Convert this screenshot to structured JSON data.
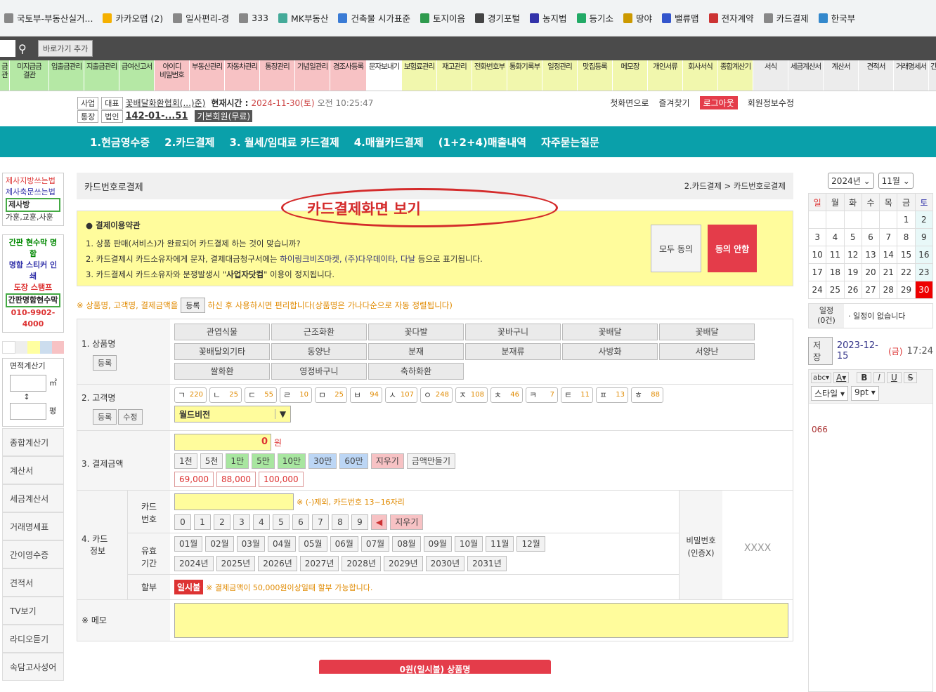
{
  "bookmarks": [
    "국토부-부동산실거...",
    "카카오맵 (2)",
    "일사편리-경",
    "333",
    "MK부동산",
    "건축물 시가표준",
    "토지이음",
    "경기포털",
    "농지법",
    "등기소",
    "땅야",
    "밸류맵",
    "전자계약",
    "카드결제",
    "한국부"
  ],
  "goto_label": "바로가기 추가",
  "menu": [
    {
      "l1": "금",
      "l2": "관",
      "c": "c-g",
      "w": 14
    },
    {
      "l1": "미지급금",
      "l2": "결관",
      "c": "c-g",
      "w": 56
    },
    {
      "l1": "입출금관리",
      "l2": "",
      "c": "c-g",
      "w": 50
    },
    {
      "l1": "지출금관리",
      "l2": "",
      "c": "c-g",
      "w": 50
    },
    {
      "l1": "급여신고서",
      "l2": "",
      "c": "c-g",
      "w": 50
    },
    {
      "l1": "아이디",
      "l2": "비밀번호",
      "c": "c-p",
      "w": 50
    },
    {
      "l1": "부동산관리",
      "l2": "",
      "c": "c-p",
      "w": 50
    },
    {
      "l1": "자동차관리",
      "l2": "",
      "c": "c-p",
      "w": 50
    },
    {
      "l1": "통장관리",
      "l2": "",
      "c": "c-p",
      "w": 50
    },
    {
      "l1": "기념일관리",
      "l2": "",
      "c": "c-p",
      "w": 50
    },
    {
      "l1": "경조사등록",
      "l2": "",
      "c": "c-p",
      "w": 52
    },
    {
      "l1": "문자보내기",
      "l2": "",
      "c": "c-w",
      "w": 50
    },
    {
      "l1": "보험료관리",
      "l2": "",
      "c": "c-y",
      "w": 50
    },
    {
      "l1": "재고관리",
      "l2": "",
      "c": "c-y",
      "w": 50
    },
    {
      "l1": "전화번호부",
      "l2": "",
      "c": "c-y",
      "w": 50
    },
    {
      "l1": "통화기록부",
      "l2": "",
      "c": "c-y",
      "w": 50
    },
    {
      "l1": "일정관리",
      "l2": "",
      "c": "c-y",
      "w": 50
    },
    {
      "l1": "맛집등록",
      "l2": "",
      "c": "c-y",
      "w": 50
    },
    {
      "l1": "메모장",
      "l2": "",
      "c": "c-y",
      "w": 50
    },
    {
      "l1": "개인서류",
      "l2": "",
      "c": "c-y",
      "w": 50
    },
    {
      "l1": "회사서식",
      "l2": "",
      "c": "c-y",
      "w": 50
    },
    {
      "l1": "종합계산기",
      "l2": "",
      "c": "c-y",
      "w": 50
    },
    {
      "l1": "서식",
      "l2": "",
      "c": "c-gr",
      "w": 50
    },
    {
      "l1": "세금계산서",
      "l2": "",
      "c": "c-gr",
      "w": 50
    },
    {
      "l1": "계산서",
      "l2": "",
      "c": "c-gr",
      "w": 50
    },
    {
      "l1": "견적서",
      "l2": "",
      "c": "c-gr",
      "w": 50
    },
    {
      "l1": "거래명세서",
      "l2": "",
      "c": "c-gr",
      "w": 50
    },
    {
      "l1": "간",
      "l2": "",
      "c": "c-gr",
      "w": 14
    }
  ],
  "info": {
    "tag_biz": "사업",
    "tag_rep": "대표",
    "company": "꽃배달화환협회(...)준)",
    "tag_bank": "통장",
    "tag_corp": "법인",
    "biznum": "142-01-...51",
    "time_label": "현재시간 :",
    "date": "2024-11-30",
    "dow": "(토)",
    "time": "오전 10:25:47",
    "member": "기본회원(무료)",
    "home": "첫화면으로",
    "fav": "즐겨찾기",
    "logout": "로그아웃",
    "edit": "회원정보수정"
  },
  "nav": [
    "1.현금영수증",
    "2.카드결제",
    "3. 월세/임대료 카드결제",
    "4.매월카드결제",
    "(1+2+4)매출내역",
    "자주묻는질문"
  ],
  "left": {
    "a1": "제사지방쓰는법",
    "a2": "제사축문쓰는법",
    "a3": "제사방",
    "a4": "가훈,교훈,사훈",
    "b1": "간판 현수막 명함",
    "b2": "명함 스티커 인쇄",
    "b3": "도장 스탬프",
    "b4": "간판명함현수막",
    "phone": "010-9902-4000",
    "calc": "면적계산기",
    "unit1": "㎡",
    "unit2": "평",
    "btns": [
      "종합계산기",
      "계산서",
      "세금계산서",
      "거래명세표",
      "간이영수증",
      "견적서",
      "TV보기",
      "라디오듣기",
      "속담고사성어"
    ]
  },
  "header": {
    "title": "카드번호로결제",
    "crumb": "2.카드결제 > 카드번호로결제"
  },
  "bubble": "카드결제화면 보기",
  "terms": {
    "title": "● 결제이용약관",
    "l1": "1. 상품 판매(서비스)가 완료되어 카드결제 하는 것이 맞습니까?",
    "l2a": "2. 카드결제시 카드소유자에게 문자, 결제대금청구서에는 ",
    "l2b": "하이링크비즈마켓, (주)다우데이타, 다날",
    "l2c": " 등으로 표기됩니다.",
    "l3a": "3. 카드결제시 카드소유자와 분쟁발생시 \"",
    "l3b": "사업자닷컴",
    "l3c": "\" 이용이 정지됩니다.",
    "agree_all": "모두 동의",
    "disagree": "동의 안함"
  },
  "note": {
    "a": "※ 상품명, 고객명, 결제금액을",
    "btn": "등록",
    "b": "하신 후 사용하시면 편리합니다(상품명은 가나다순으로 자동 정렬됩니다)"
  },
  "product": {
    "label": "1. 상품명",
    "reg": "등록",
    "items": [
      "관엽식물",
      "근조화환",
      "꽃다발",
      "꽃바구니",
      "꽃배달",
      "꽃배달",
      "꽃배달외기타",
      "동양난",
      "분재",
      "분재류",
      "사방화",
      "서양난",
      "쌀화환",
      "영정바구니",
      "축하화환"
    ]
  },
  "customer": {
    "label": "2. 고객명",
    "reg": "등록",
    "edit": "수정",
    "initials": [
      [
        "ㄱ",
        "220"
      ],
      [
        "ㄴ",
        "25"
      ],
      [
        "ㄷ",
        "55"
      ],
      [
        "ㄹ",
        "10"
      ],
      [
        "ㅁ",
        "25"
      ],
      [
        "ㅂ",
        "94"
      ],
      [
        "ㅅ",
        "107"
      ],
      [
        "ㅇ",
        "248"
      ],
      [
        "ㅈ",
        "108"
      ],
      [
        "ㅊ",
        "46"
      ],
      [
        "ㅋ",
        "7"
      ],
      [
        "ㅌ",
        "11"
      ],
      [
        "ㅍ",
        "13"
      ],
      [
        "ㅎ",
        "88"
      ]
    ],
    "selected": "월드비전"
  },
  "amount": {
    "label": "3. 결제금액",
    "value": "0",
    "unit": "원",
    "quick": [
      "1천",
      "5천",
      "1만",
      "5만",
      "10만",
      "30만",
      "60만",
      "지우기",
      "금액만들기"
    ],
    "presets": [
      "69,000",
      "88,000",
      "100,000"
    ]
  },
  "card": {
    "label1": "4. 카드",
    "label2": "정보",
    "num1": "카드",
    "num2": "번호",
    "hint": "※ (-)제외, 카드번호 13~16자리",
    "digits": [
      "0",
      "1",
      "2",
      "3",
      "4",
      "5",
      "6",
      "7",
      "8",
      "9"
    ],
    "back": "◀",
    "clear": "지우기",
    "exp1": "유효",
    "exp2": "기간",
    "months": [
      "01월",
      "02월",
      "03월",
      "04월",
      "05월",
      "06월",
      "07월",
      "08월",
      "09월",
      "10월",
      "11월",
      "12월"
    ],
    "years": [
      "2024년",
      "2025년",
      "2026년",
      "2027년",
      "2028년",
      "2029년",
      "2030년",
      "2031년"
    ],
    "inst": "할부",
    "inst_btn": "일시불",
    "inst_note": "※ 결제금액이 50,000원이상일때 할부 가능합니다.",
    "pw1": "비밀번호",
    "pw2": "(인증X)",
    "pw_val": "XXXX"
  },
  "memo": {
    "label": "※ 메모"
  },
  "submit": "0원(일시불) 상품명",
  "cal": {
    "year": "2024년",
    "month": "11월",
    "dow": [
      "일",
      "월",
      "화",
      "수",
      "목",
      "금",
      "토"
    ],
    "weeks": [
      [
        "",
        "",
        "",
        "",
        "",
        "1",
        "2"
      ],
      [
        "3",
        "4",
        "5",
        "6",
        "7",
        "8",
        "9"
      ],
      [
        "10",
        "11",
        "12",
        "13",
        "14",
        "15",
        "16"
      ],
      [
        "17",
        "18",
        "19",
        "20",
        "21",
        "22",
        "23"
      ],
      [
        "24",
        "25",
        "26",
        "27",
        "28",
        "29",
        "30"
      ]
    ],
    "sched1": "일정",
    "sched2": "(0건)",
    "none": "· 일정이 없습니다",
    "save": "저장",
    "memo_date": "2023-12-15",
    "memo_dow": "(금)",
    "memo_time": "17:24",
    "style": "스타일",
    "size": "9pt",
    "text": "066"
  }
}
